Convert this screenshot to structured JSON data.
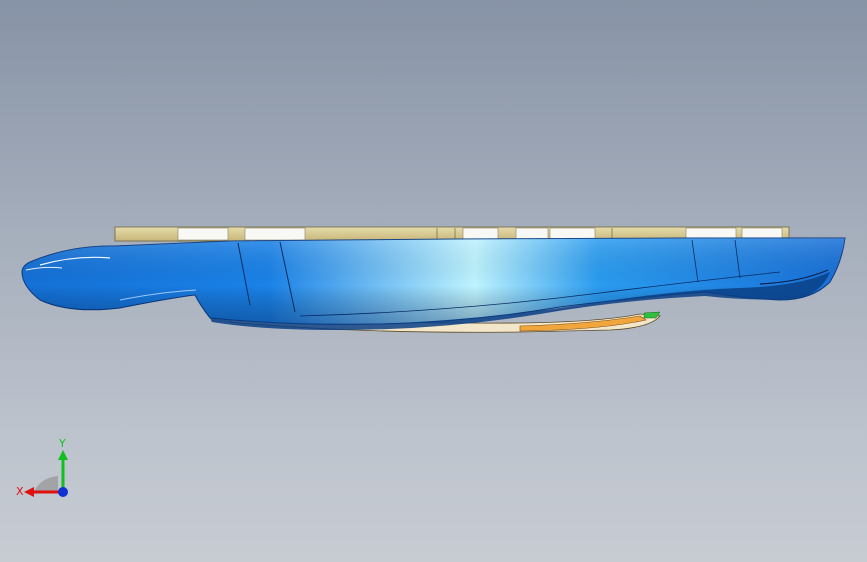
{
  "view": {
    "colors": {
      "background_top": "#8793a6",
      "background_bottom": "#c7ccd3",
      "body_blue": "#1a7fe0",
      "body_highlight": "#bff4ff",
      "body_dark": "#0b3f86",
      "tray_tan": "#dccf9a",
      "tray_white": "#f8f8f4",
      "underside_orange": "#f0a63c"
    }
  },
  "triad": {
    "x_label": "X",
    "y_label": "Y",
    "x_color": "#e01010",
    "y_color": "#10c020",
    "z_color": "#1030d0"
  }
}
